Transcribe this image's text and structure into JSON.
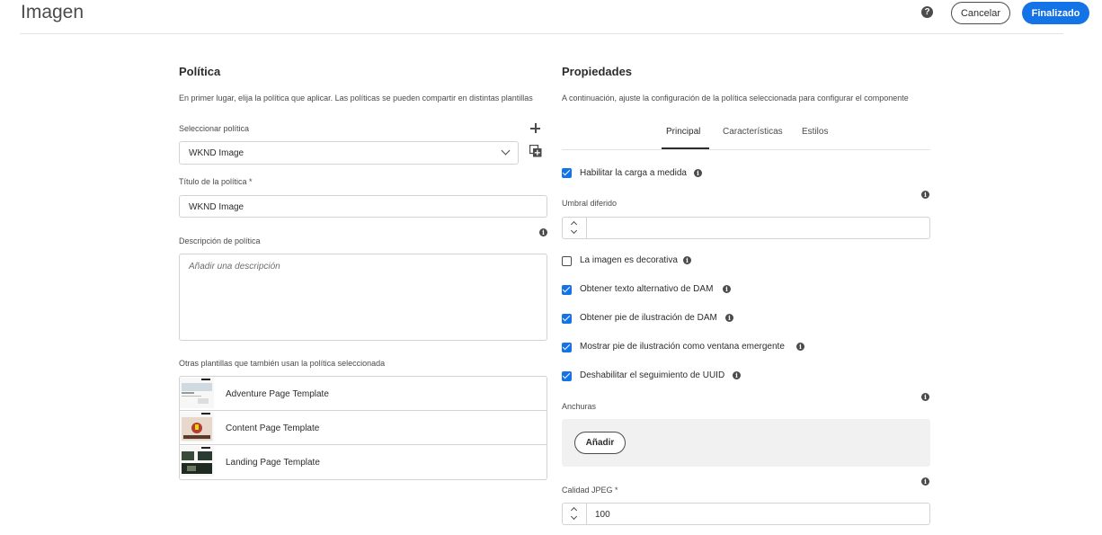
{
  "header": {
    "title": "Imagen",
    "cancel_label": "Cancelar",
    "done_label": "Finalizado",
    "help_glyph": "?"
  },
  "policy": {
    "title": "Política",
    "description": "En primer lugar, elija la política que aplicar. Las políticas se pueden compartir en distintas plantillas",
    "select_label": "Seleccionar política",
    "selected_value": "WKND Image",
    "title_label": "Título de la política *",
    "title_value": "WKND Image",
    "desc_label": "Descripción de política",
    "desc_placeholder": "Añadir una descripción",
    "other_templates_label": "Otras plantillas que también usan la política seleccionada",
    "templates": [
      {
        "label": "Adventure Page Template"
      },
      {
        "label": "Content Page Template"
      },
      {
        "label": "Landing Page Template"
      }
    ]
  },
  "properties": {
    "title": "Propiedades",
    "description": "A continuación, ajuste la configuración de la política seleccionada para configurar el componente",
    "tabs": [
      {
        "label": "Principal",
        "active": true
      },
      {
        "label": "Características",
        "active": false
      },
      {
        "label": "Estilos",
        "active": false
      }
    ],
    "lazy_loading": {
      "label": "Habilitar la carga a medida",
      "checked": true
    },
    "lazy_threshold_label": "Umbral diferido",
    "lazy_threshold_value": "",
    "options": [
      {
        "label": "La imagen es decorativa",
        "checked": false
      },
      {
        "label": "Obtener texto alternativo de DAM",
        "checked": true
      },
      {
        "label": "Obtener pie de ilustración de DAM",
        "checked": true
      },
      {
        "label": "Mostrar pie de ilustración como ventana emergente",
        "checked": true
      },
      {
        "label": "Deshabilitar el seguimiento de UUID",
        "checked": true
      }
    ],
    "widths_label": "Anchuras",
    "add_label": "Añadir",
    "jpeg_label": "Calidad JPEG *",
    "jpeg_value": "100"
  },
  "colors": {
    "accent": "#1473e6",
    "text": "#2c2c2c",
    "border": "#d3d3d3"
  },
  "icons": {
    "info": "info-icon",
    "help": "help-icon",
    "add": "plus-icon",
    "copy": "copy-icon",
    "dropdown": "chevron-down-icon"
  }
}
